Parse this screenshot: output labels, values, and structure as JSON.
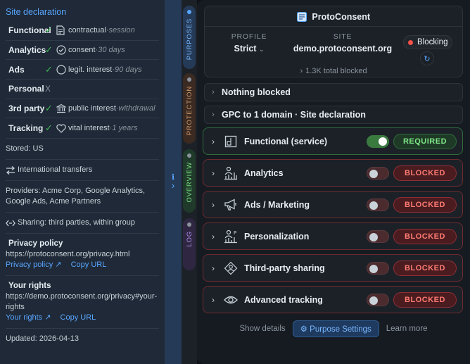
{
  "declaration": {
    "title": "Site declaration",
    "rows": [
      {
        "name": "Functional",
        "status": "✓",
        "icon": "document-icon",
        "basis": "contractual",
        "duration": "session"
      },
      {
        "name": "Analytics",
        "status": "✓",
        "icon": "check-circle-icon",
        "basis": "consent",
        "duration": "30 days"
      },
      {
        "name": "Ads",
        "status": "✓",
        "icon": "circle-icon",
        "basis": "legit. interest",
        "duration": "90 days"
      },
      {
        "name": "Personal",
        "status": "X"
      },
      {
        "name": "3rd party",
        "status": "✓",
        "icon": "bank-icon",
        "basis": "public interest",
        "duration": "withdrawal"
      },
      {
        "name": "Tracking",
        "status": "✓",
        "icon": "heart-icon",
        "basis": "vital interest",
        "duration": "1 years"
      }
    ],
    "stored": "Stored: US",
    "transfers": "International transfers",
    "providers": "Providers: Acme Corp, Google Analytics, Google Ads, Acme Partners",
    "sharing": "Sharing: third parties, within group",
    "privacy": {
      "heading": "Privacy policy",
      "url": "https://protoconsent.org/privacy.html",
      "link": "Privacy policy ↗",
      "copy": "Copy URL"
    },
    "rights": {
      "heading": "Your rights",
      "url": "https://demo.protoconsent.org/privacy#your-rights",
      "link": "Your rights ↗",
      "copy": "Copy URL"
    },
    "updated": "Updated: 2026-04-13"
  },
  "divider": {
    "info_icon": "ℹ",
    "arrow": "›"
  },
  "vtabs": [
    {
      "label": "PURPOSES",
      "dot": "#58a6ff",
      "bg": "#253a56",
      "color": "#79b8ff"
    },
    {
      "label": "PROTECTION",
      "dot": "#8b949e",
      "bg": "#3a2a22",
      "color": "#d29a6b"
    },
    {
      "label": "OVERVIEW",
      "dot": "#8b949e",
      "bg": "#1f3a2a",
      "color": "#7ee787"
    },
    {
      "label": "LOG",
      "dot": "#8b949e",
      "bg": "#2f2742",
      "color": "#b392f0"
    }
  ],
  "header": {
    "brand": "ProtoConsent",
    "profile_label": "PROFILE",
    "profile_value": "Strict",
    "site_label": "SITE",
    "site_value": "demo.protoconsent.org",
    "status": "Blocking",
    "total": "1.3K total blocked"
  },
  "rows": {
    "nothing_blocked": "Nothing blocked",
    "gpc": "GPC to 1 domain · Site declaration"
  },
  "purposes": [
    {
      "name": "Functional (service)",
      "icon": "functional-icon",
      "on": true,
      "badge": "REQUIRED",
      "state": "required"
    },
    {
      "name": "Analytics",
      "icon": "analytics-icon",
      "on": false,
      "badge": "BLOCKED",
      "state": "blocked"
    },
    {
      "name": "Ads / Marketing",
      "icon": "megaphone-icon",
      "on": false,
      "badge": "BLOCKED",
      "state": "blocked"
    },
    {
      "name": "Personalization",
      "icon": "personalization-icon",
      "on": false,
      "badge": "BLOCKED",
      "state": "blocked"
    },
    {
      "name": "Third-party sharing",
      "icon": "share-icon",
      "on": false,
      "badge": "BLOCKED",
      "state": "blocked"
    },
    {
      "name": "Advanced tracking",
      "icon": "eye-icon",
      "on": false,
      "badge": "BLOCKED",
      "state": "blocked"
    }
  ],
  "footer": {
    "show_details": "Show details",
    "purpose_settings": "⚙ Purpose Settings",
    "learn_more": "Learn more"
  }
}
